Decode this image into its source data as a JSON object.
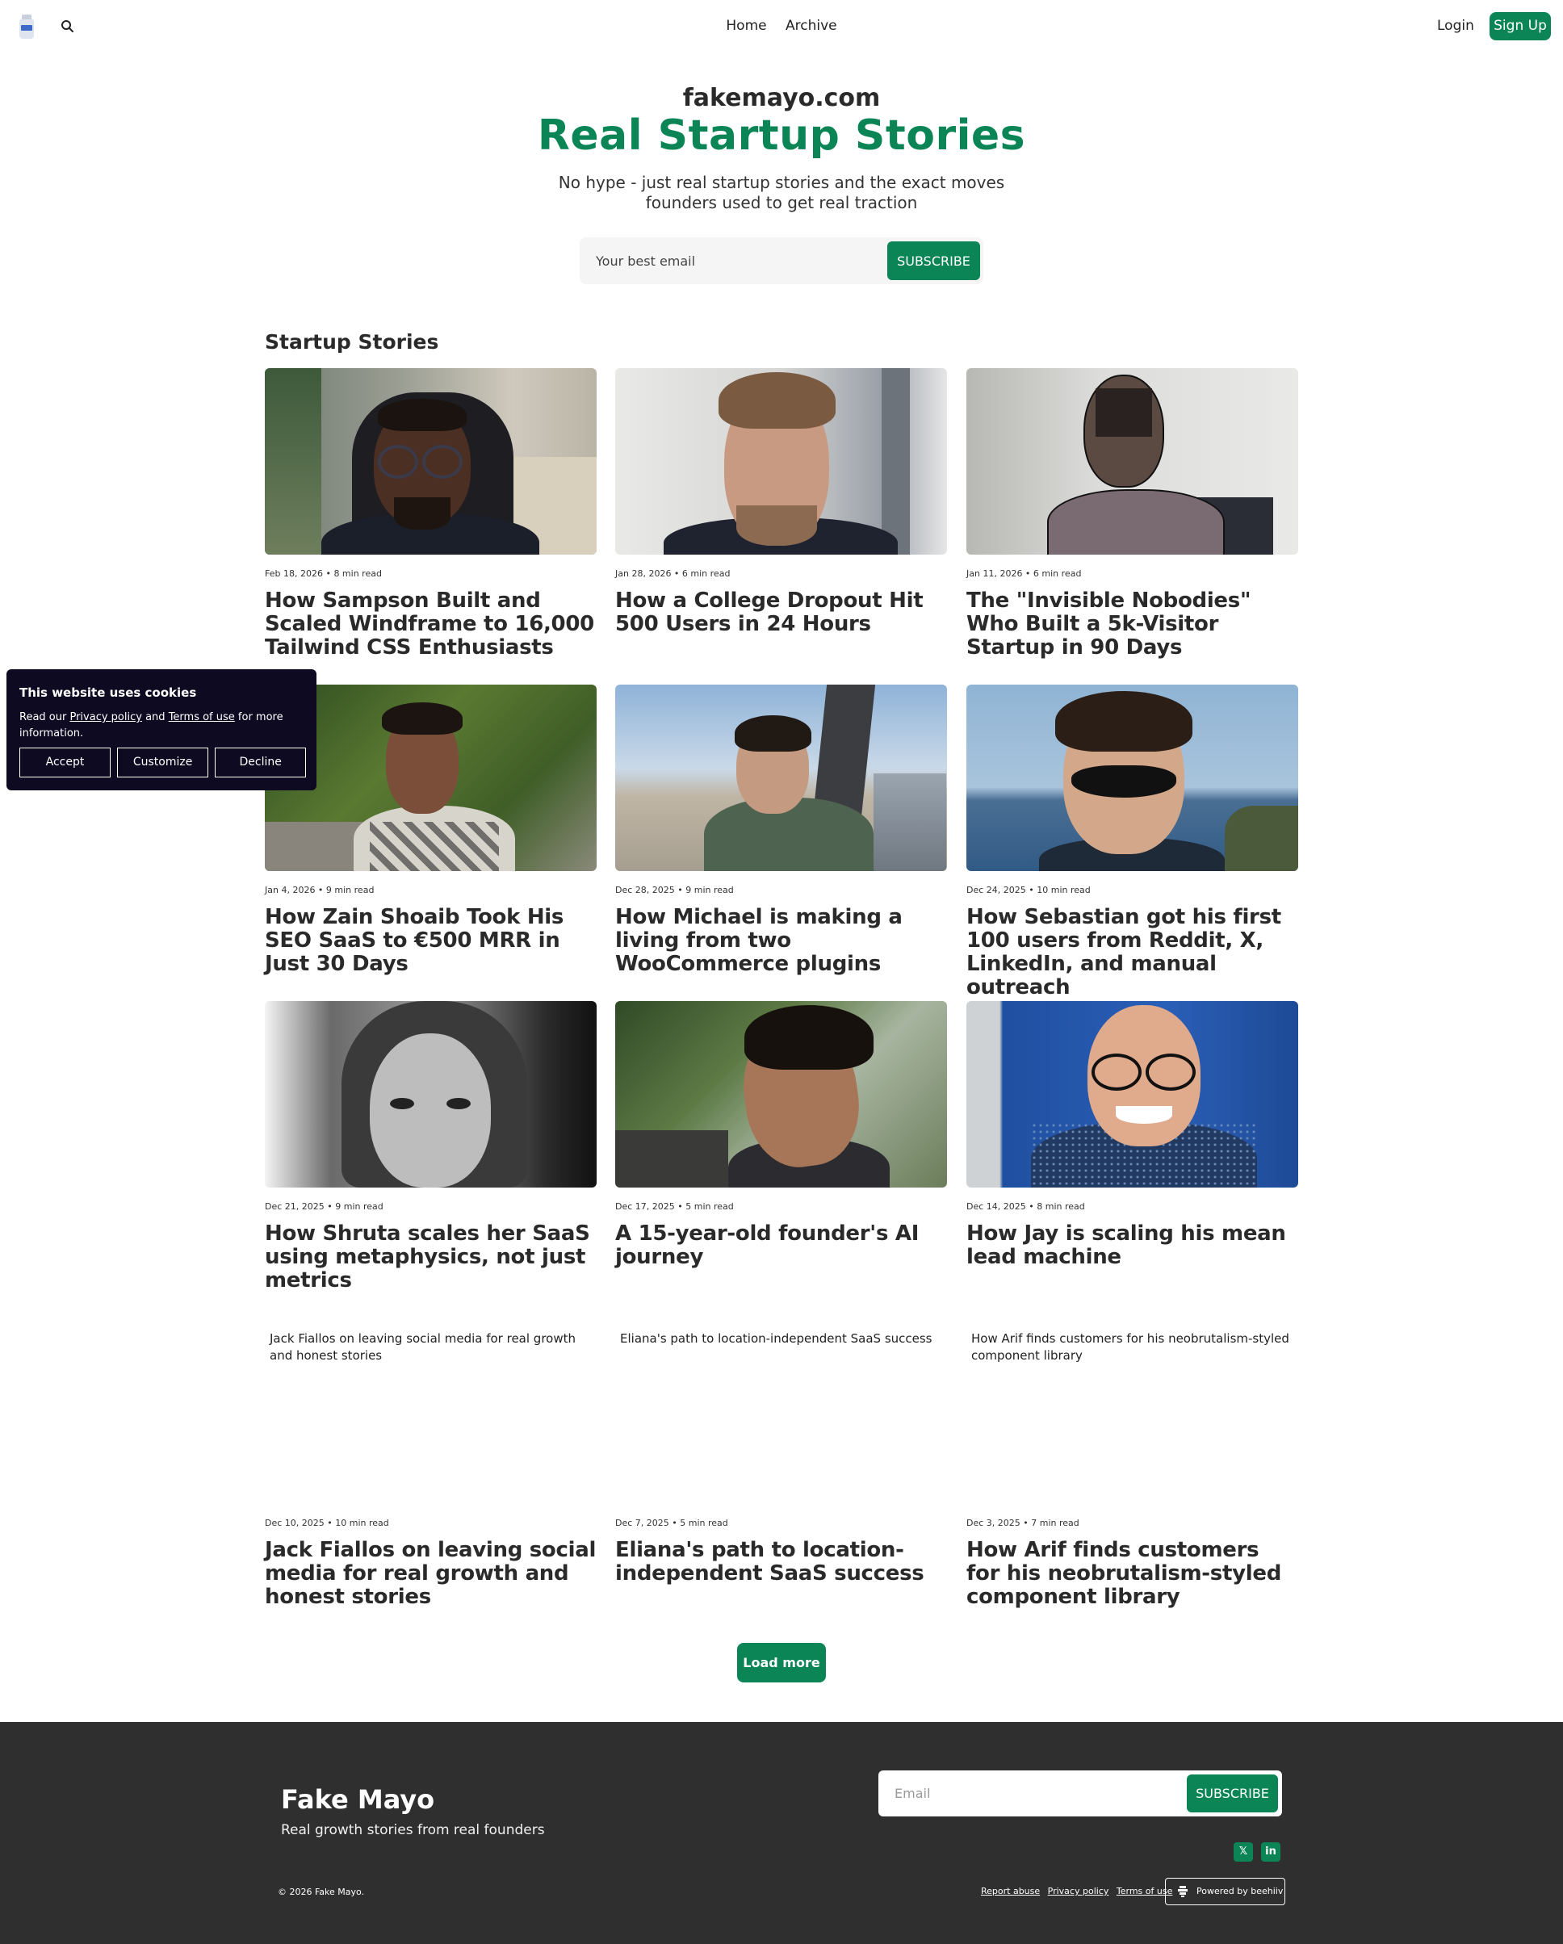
{
  "nav": {
    "links": [
      "Home",
      "Archive"
    ],
    "login": "Login",
    "signup": "Sign Up",
    "logo_icon": "bottle-logo-icon",
    "search_icon": "search-icon"
  },
  "hero": {
    "domain": "fakemayo.com",
    "title": "Real Startup Stories",
    "subtitle": "No hype - just real startup stories and the exact moves founders used to get real traction",
    "email_placeholder": "Your best email",
    "subscribe": "SUBSCRIBE"
  },
  "section_title": "Startup Stories",
  "posts": [
    {
      "meta": "Feb 18, 2026 • 8 min read",
      "title": "How Sampson Built and Scaled Windframe to 16,000 Tailwind CSS Enthusiasts"
    },
    {
      "meta": "Jan 28, 2026 • 6 min read",
      "title": "How a College Dropout Hit 500 Users in 24 Hours"
    },
    {
      "meta": "Jan 11, 2026 • 6 min read",
      "title": "The \"Invisible Nobodies\" Who Built a 5k-Visitor Startup in 90 Days"
    },
    {
      "meta": "Jan 4, 2026 • 9 min read",
      "title": "How Zain Shoaib Took His SEO SaaS to €500 MRR in Just 30 Days"
    },
    {
      "meta": "Dec 28, 2025 • 9 min read",
      "title": "How Michael is making a living from two WooCommerce plugins"
    },
    {
      "meta": "Dec 24, 2025 • 10 min read",
      "title": "How Sebastian got his first 100 users from Reddit, X, LinkedIn, and manual outreach"
    },
    {
      "meta": "Dec 21, 2025 • 9 min read",
      "title": "How Shruta scales her SaaS using metaphysics, not just metrics"
    },
    {
      "meta": "Dec 17, 2025 • 5 min read",
      "title": "A 15-year-old founder's AI journey"
    },
    {
      "meta": "Dec 14, 2025 • 8 min read",
      "title": "How Jay is scaling his mean lead machine"
    },
    {
      "meta": "Dec 10, 2025 • 10 min read",
      "title": "Jack Fiallos on leaving social media for real growth and honest stories",
      "thumb_text": "Jack Fiallos on leaving social media for real growth and honest stories"
    },
    {
      "meta": "Dec 7, 2025 • 5 min read",
      "title": "Eliana's path to location-independent SaaS success",
      "thumb_text": "Eliana's path to location-independent SaaS success"
    },
    {
      "meta": "Dec 3, 2025 • 7 min read",
      "title": "How Arif finds customers for his neobrutalism-styled component library",
      "thumb_text": "How Arif finds customers for his neobrutalism-styled component library"
    }
  ],
  "load_more": "Load more",
  "cookie": {
    "title": "This website uses cookies",
    "text_before": "Read our ",
    "privacy": "Privacy policy",
    "text_and": " and ",
    "terms": "Terms of use",
    "text_after": " for more information.",
    "accept": "Accept",
    "customize": "Customize",
    "decline": "Decline"
  },
  "footer": {
    "brand": "Fake Mayo",
    "tagline": "Real growth stories from real founders",
    "email_placeholder": "Email",
    "subscribe": "SUBSCRIBE",
    "social": [
      {
        "icon": "x-icon",
        "glyph": "𝕏"
      },
      {
        "icon": "linkedin-icon",
        "glyph": "in"
      }
    ],
    "copyright": "© 2026 Fake Mayo.",
    "links": [
      "Report abuse",
      "Privacy policy",
      "Terms of use"
    ],
    "powered": "Powered by beehiiv"
  },
  "colors": {
    "accent": "#0b8556",
    "cookie_bg": "#0d0a22",
    "footer_bg": "#2f2f2f"
  }
}
